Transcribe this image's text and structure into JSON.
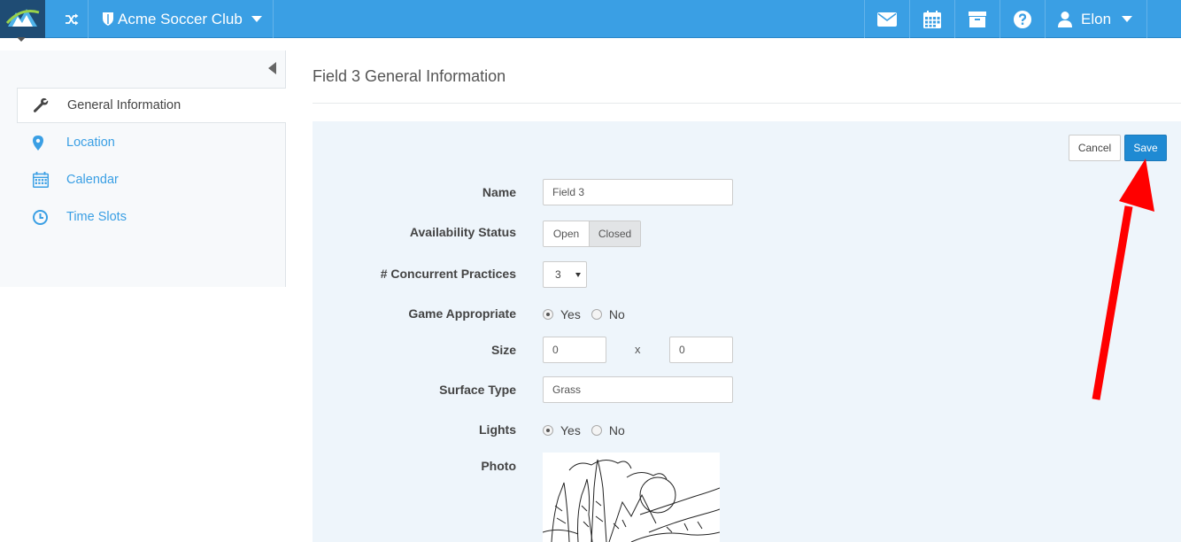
{
  "topbar": {
    "club_name": "Acme Soccer Club",
    "user_name": "Elon",
    "accent": "#3a9fe4",
    "icons": [
      "mail-icon",
      "calendar-icon",
      "archive-icon",
      "help-icon",
      "user-icon"
    ]
  },
  "sidebar": {
    "items": [
      {
        "label": "General Information",
        "icon": "wrench-icon",
        "active": true
      },
      {
        "label": "Location",
        "icon": "map-marker-icon",
        "active": false
      },
      {
        "label": "Calendar",
        "icon": "calendar-icon",
        "active": false
      },
      {
        "label": "Time Slots",
        "icon": "clock-icon",
        "active": false
      }
    ]
  },
  "main": {
    "title": "Field 3 General Information",
    "actions": {
      "cancel_label": "Cancel",
      "save_label": "Save"
    },
    "form": {
      "name": {
        "label": "Name",
        "value": "Field 3"
      },
      "availability": {
        "label": "Availability Status",
        "options": [
          "Open",
          "Closed"
        ],
        "selected": "Closed"
      },
      "concurrent": {
        "label": "# Concurrent Practices",
        "value": "3"
      },
      "game_appropriate": {
        "label": "Game Appropriate",
        "yes": "Yes",
        "no": "No",
        "selected": "Yes"
      },
      "size": {
        "label": "Size",
        "width": "0",
        "separator": "x",
        "length": "0"
      },
      "surface": {
        "label": "Surface Type",
        "value": "Grass"
      },
      "lights": {
        "label": "Lights",
        "yes": "Yes",
        "no": "No",
        "selected": "Yes"
      },
      "photo": {
        "label": "Photo"
      }
    }
  },
  "annotation": {
    "color": "#ff0000"
  }
}
